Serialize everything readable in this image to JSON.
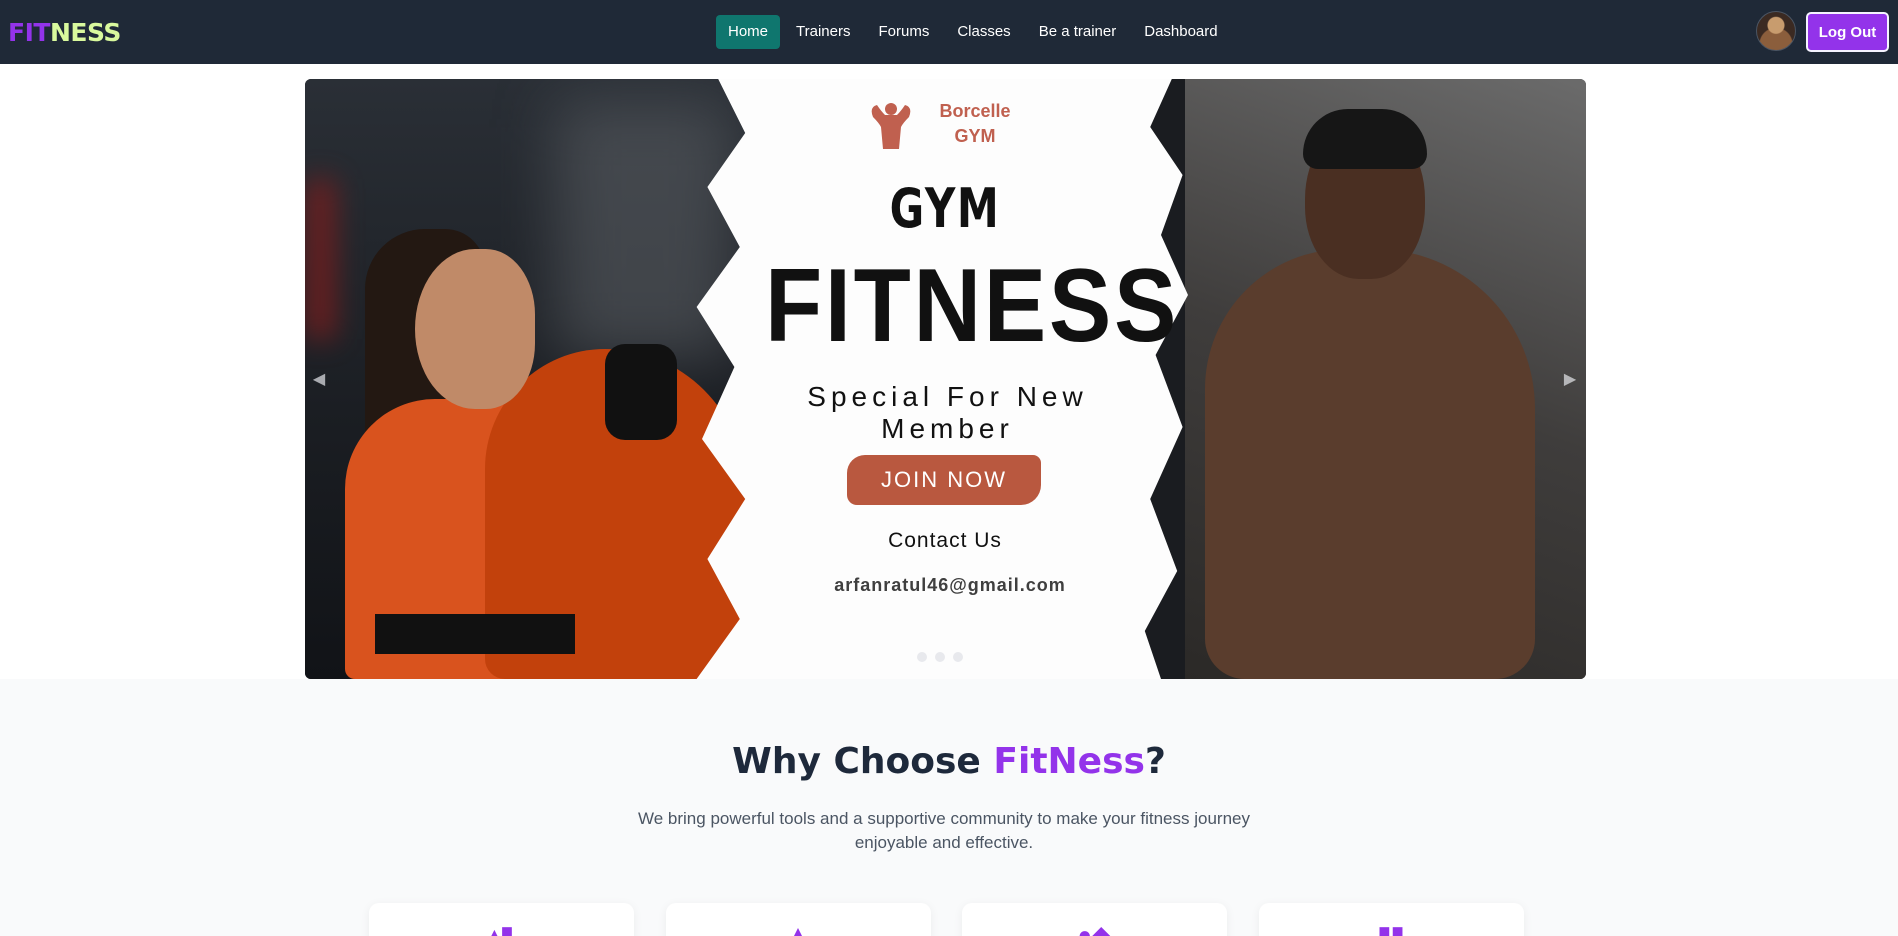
{
  "nav": {
    "logo_part1": "FIT",
    "logo_part2": "NESS",
    "links": [
      "Home",
      "Trainers",
      "Forums",
      "Classes",
      "Be a trainer",
      "Dashboard"
    ],
    "active": "Home",
    "logout_label": "Log Out"
  },
  "hero": {
    "brand_line1": "Borcelle",
    "brand_line2": "GYM",
    "gym_word": "GYM",
    "fitness_word": "FITNESS",
    "tagline": "Special For New Member",
    "join_label": "JOIN NOW",
    "contact_label": "Contact Us",
    "email": "arfanratul46@gmail.com",
    "prev_arrow": "◀",
    "next_arrow": "▶",
    "slide_count": 3
  },
  "why": {
    "title_part1": "Why Choose ",
    "title_accent": "FitNess",
    "title_part2": "?",
    "subtitle": "We bring powerful tools and a supportive community to make your fitness journey enjoyable and effective."
  },
  "colors": {
    "nav_bg": "#1f2937",
    "active_link_bg": "#0f766e",
    "brand_purple": "#9333ea",
    "logo_lime": "#d9f99d",
    "join_button": "#b9583f"
  }
}
